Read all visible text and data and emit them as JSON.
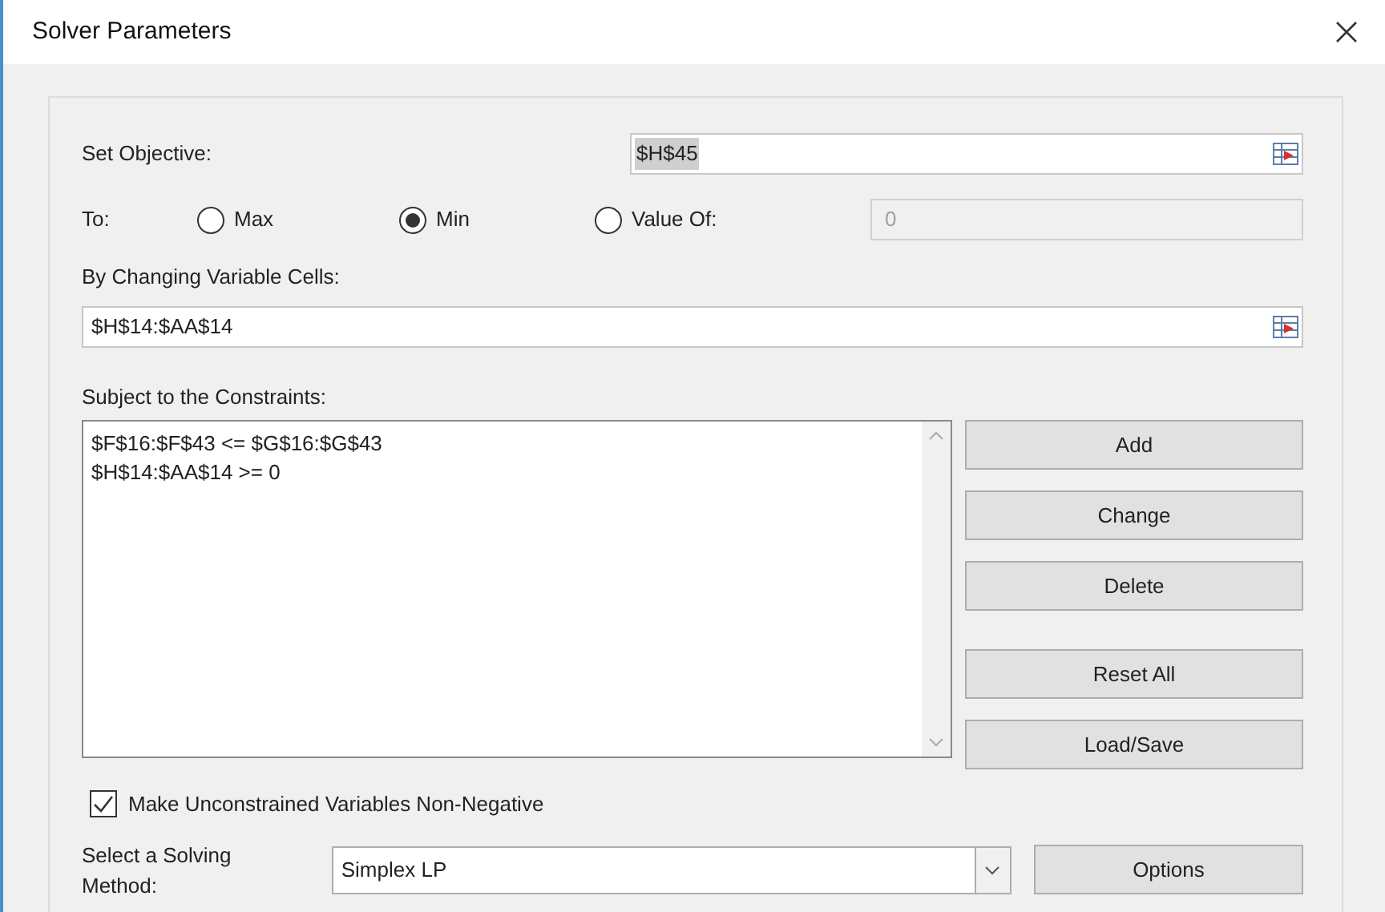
{
  "window": {
    "title": "Solver Parameters"
  },
  "objective": {
    "label": "Set Objective:",
    "value": "$H$45"
  },
  "to": {
    "label": "To:",
    "options": [
      {
        "label": "Max",
        "selected": false
      },
      {
        "label": "Min",
        "selected": true
      },
      {
        "label": "Value Of:",
        "selected": false
      }
    ],
    "value_field": {
      "value": "0",
      "disabled": true
    }
  },
  "changing_cells": {
    "label": "By Changing Variable Cells:",
    "value": "$H$14:$AA$14"
  },
  "constraints": {
    "label": "Subject to the Constraints:",
    "items": [
      "$F$16:$F$43 <= $G$16:$G$43",
      "$H$14:$AA$14 >= 0"
    ]
  },
  "constraint_buttons": [
    "Add",
    "Change",
    "Delete",
    "Reset All",
    "Load/Save"
  ],
  "non_negative": {
    "label": "Make Unconstrained Variables Non-Negative",
    "checked": true
  },
  "method": {
    "label": "Select a Solving Method:",
    "value": "Simplex LP"
  },
  "options_button": "Options"
}
